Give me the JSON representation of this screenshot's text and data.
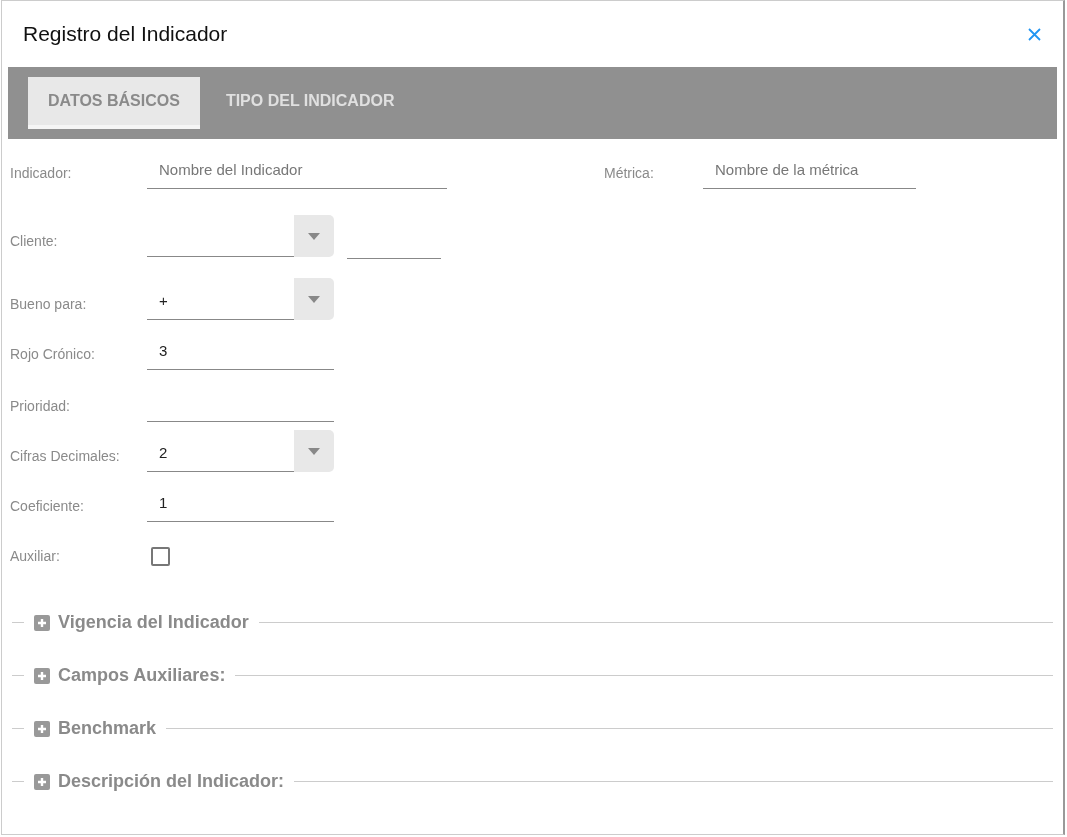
{
  "dialog": {
    "title": "Registro del Indicador"
  },
  "tabs": [
    {
      "label": "DATOS BÁSICOS",
      "selected": true
    },
    {
      "label": "TIPO DEL INDICADOR",
      "selected": false
    }
  ],
  "top_row": [
    {
      "label": "Indicador:",
      "placeholder": "Nombre del Indicador"
    },
    {
      "label": "Métrica:",
      "placeholder": "Nombre de la métrica"
    }
  ],
  "fields": [
    {
      "label": "Cliente:",
      "kind": "select-extra"
    },
    {
      "label": "Bueno para:",
      "kind": "select",
      "value": "+"
    },
    {
      "label": "Rojo Crónico:",
      "kind": "text",
      "value": "3"
    },
    {
      "label": "Prioridad:",
      "kind": "text"
    },
    {
      "label": "Cifras Decimales:",
      "kind": "select",
      "value": "2"
    },
    {
      "label": "Coeficiente:",
      "kind": "text",
      "value": "1"
    },
    {
      "label": "Auxiliar:",
      "kind": "checkbox",
      "checked": false
    }
  ],
  "sections": [
    {
      "title": "Vigencia del Indicador",
      "expanded": false
    },
    {
      "title": "Campos Auxiliares:",
      "expanded": false
    },
    {
      "title": "Benchmark",
      "expanded": false
    },
    {
      "title": "Descripción del Indicador:",
      "expanded": false
    }
  ]
}
